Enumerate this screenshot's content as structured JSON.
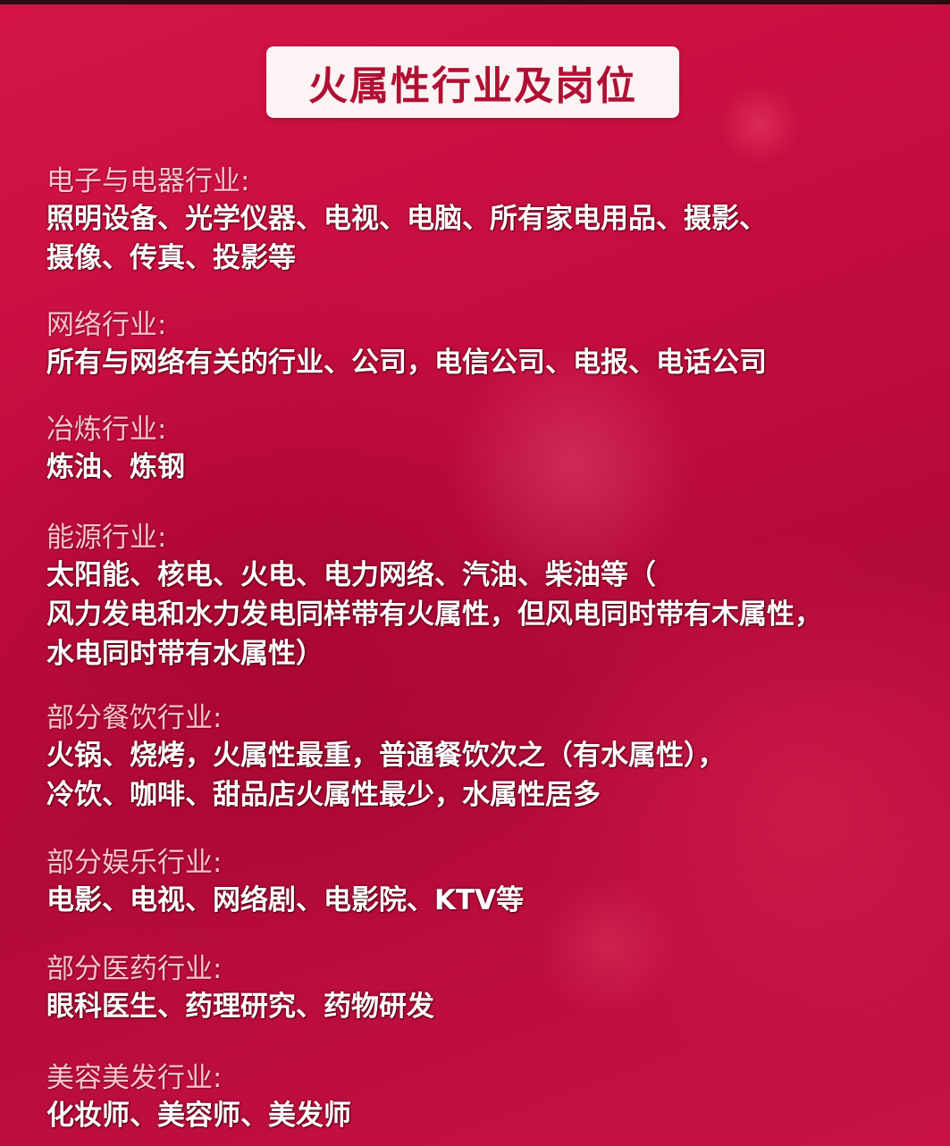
{
  "title": "火属性行业及岗位",
  "sections": [
    {
      "heading": "电子与电器行业:",
      "lines": [
        "照明设备、光学仪器、电视、电脑、所有家电用品、摄影、",
        "摄像、传真、投影等"
      ]
    },
    {
      "heading": "网络行业:",
      "lines": [
        "所有与网络有关的行业、公司，电信公司、电报、电话公司"
      ]
    },
    {
      "heading": "冶炼行业:",
      "lines": [
        "炼油、炼钢"
      ]
    },
    {
      "heading": "能源行业:",
      "lines": [
        "太阳能、核电、火电、电力网络、汽油、柴油等（",
        "风力发电和水力发电同样带有火属性，但风电同时带有木属性，",
        "水电同时带有水属性）"
      ]
    },
    {
      "heading": "部分餐饮行业:",
      "lines": [
        "火锅、烧烤，火属性最重，普通餐饮次之（有水属性），",
        "冷饮、咖啡、甜品店火属性最少，水属性居多"
      ]
    },
    {
      "heading": "部分娱乐行业:",
      "lines": [
        "电影、电视、网络剧、电影院、KTV等"
      ]
    },
    {
      "heading": "部分医药行业:",
      "lines": [
        "眼科医生、药理研究、药物研发"
      ]
    },
    {
      "heading": "美容美发行业:",
      "lines": [
        "化妆师、美容师、美发师"
      ]
    }
  ]
}
